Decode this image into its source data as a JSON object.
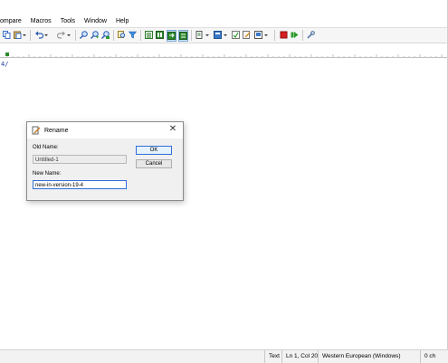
{
  "menu": [
    "ompare",
    "Macros",
    "Tools",
    "Window",
    "Help"
  ],
  "toolbar": {
    "icons": [
      "copy-icon",
      "paste-icon",
      "dropdown-icon",
      "undo-icon",
      "dropdown-icon",
      "redo-icon",
      "dropdown-icon",
      "find-icon",
      "find-next-icon",
      "find-replace-icon",
      "find-in-files-icon",
      "filter-icon",
      "column-mode-icon",
      "split-view-icon",
      "compare-icon",
      "sync-icon",
      "document-icon",
      "dropdown-icon",
      "layout-icon",
      "dropdown-icon",
      "macro-icon",
      "edit-icon",
      "view-icon",
      "dropdown-icon",
      "stop-icon",
      "play-icon",
      "settings-icon"
    ]
  },
  "editor": {
    "text": "4/"
  },
  "dialog": {
    "title": "Rename",
    "old_name_label": "Old Name:",
    "old_name_value": "Untitled-1",
    "new_name_label": "New Name:",
    "new_name_value": "new-in-version-19-4",
    "ok_label": "OK",
    "cancel_label": "Cancel",
    "close_glyph": "✕"
  },
  "status": {
    "mode": "Text",
    "position": "Ln 1, Col 20",
    "encoding": "Western European (Windows)",
    "chars": "0 ch"
  }
}
